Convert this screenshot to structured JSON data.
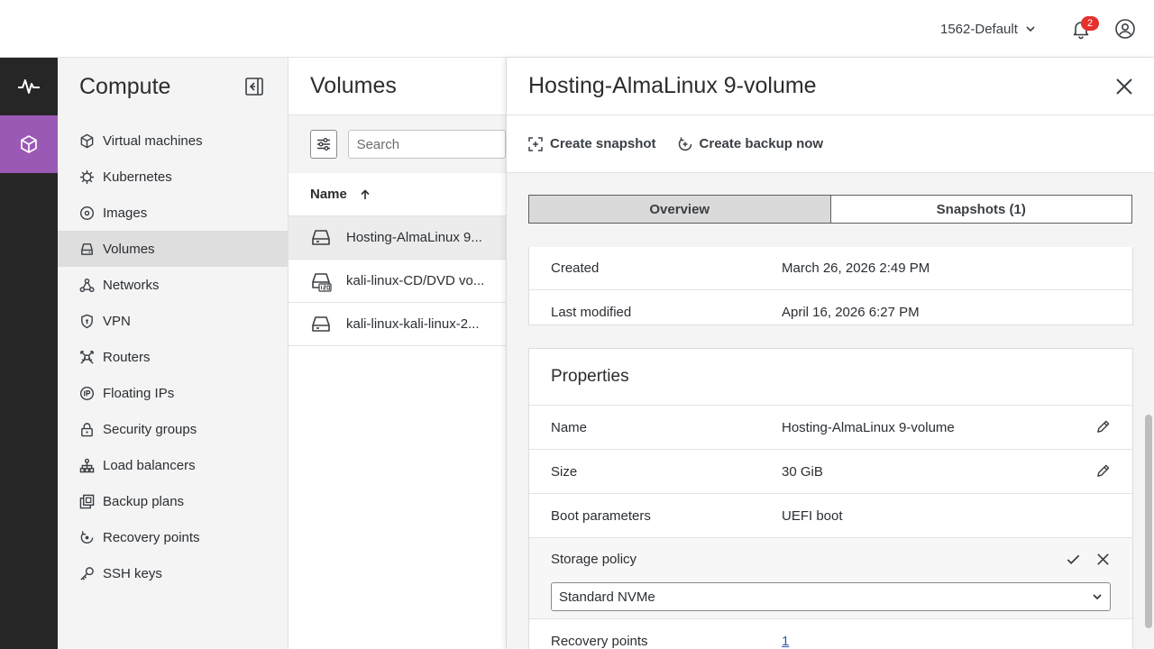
{
  "header": {
    "project": "1562-Default",
    "notifications_count": "2"
  },
  "sidenav": {
    "title": "Compute",
    "items": [
      {
        "label": "Virtual machines"
      },
      {
        "label": "Kubernetes"
      },
      {
        "label": "Images"
      },
      {
        "label": "Volumes"
      },
      {
        "label": "Networks"
      },
      {
        "label": "VPN"
      },
      {
        "label": "Routers"
      },
      {
        "label": "Floating IPs"
      },
      {
        "label": "Security groups"
      },
      {
        "label": "Load balancers"
      },
      {
        "label": "Backup plans"
      },
      {
        "label": "Recovery points"
      },
      {
        "label": "SSH keys"
      }
    ]
  },
  "volumes": {
    "title": "Volumes",
    "search_placeholder": "Search",
    "column_name": "Name",
    "rows": [
      {
        "name": "Hosting-AlmaLinux 9..."
      },
      {
        "name": "kali-linux-CD/DVD vo..."
      },
      {
        "name": "kali-linux-kali-linux-2..."
      }
    ]
  },
  "panel": {
    "title": "Hosting-AlmaLinux 9-volume",
    "actions": {
      "snapshot": "Create snapshot",
      "backup": "Create backup now"
    },
    "tabs": {
      "overview": "Overview",
      "snapshots": "Snapshots (1)"
    },
    "info": {
      "created_label": "Created",
      "created_value": "March 26, 2026 2:49 PM",
      "modified_label": "Last modified",
      "modified_value": "April 16, 2026 6:27 PM"
    },
    "properties": {
      "title": "Properties",
      "name_label": "Name",
      "name_value": "Hosting-AlmaLinux 9-volume",
      "size_label": "Size",
      "size_value": "30 GiB",
      "boot_label": "Boot parameters",
      "boot_value": "UEFI boot",
      "storage_label": "Storage policy",
      "storage_value": "Standard NVMe",
      "recovery_label": "Recovery points",
      "recovery_value": "1"
    }
  },
  "colors": {
    "rail_active": "#9b59b6",
    "rail_bg": "#262626",
    "badge": "#e5302c",
    "link": "#2f5aa8"
  }
}
